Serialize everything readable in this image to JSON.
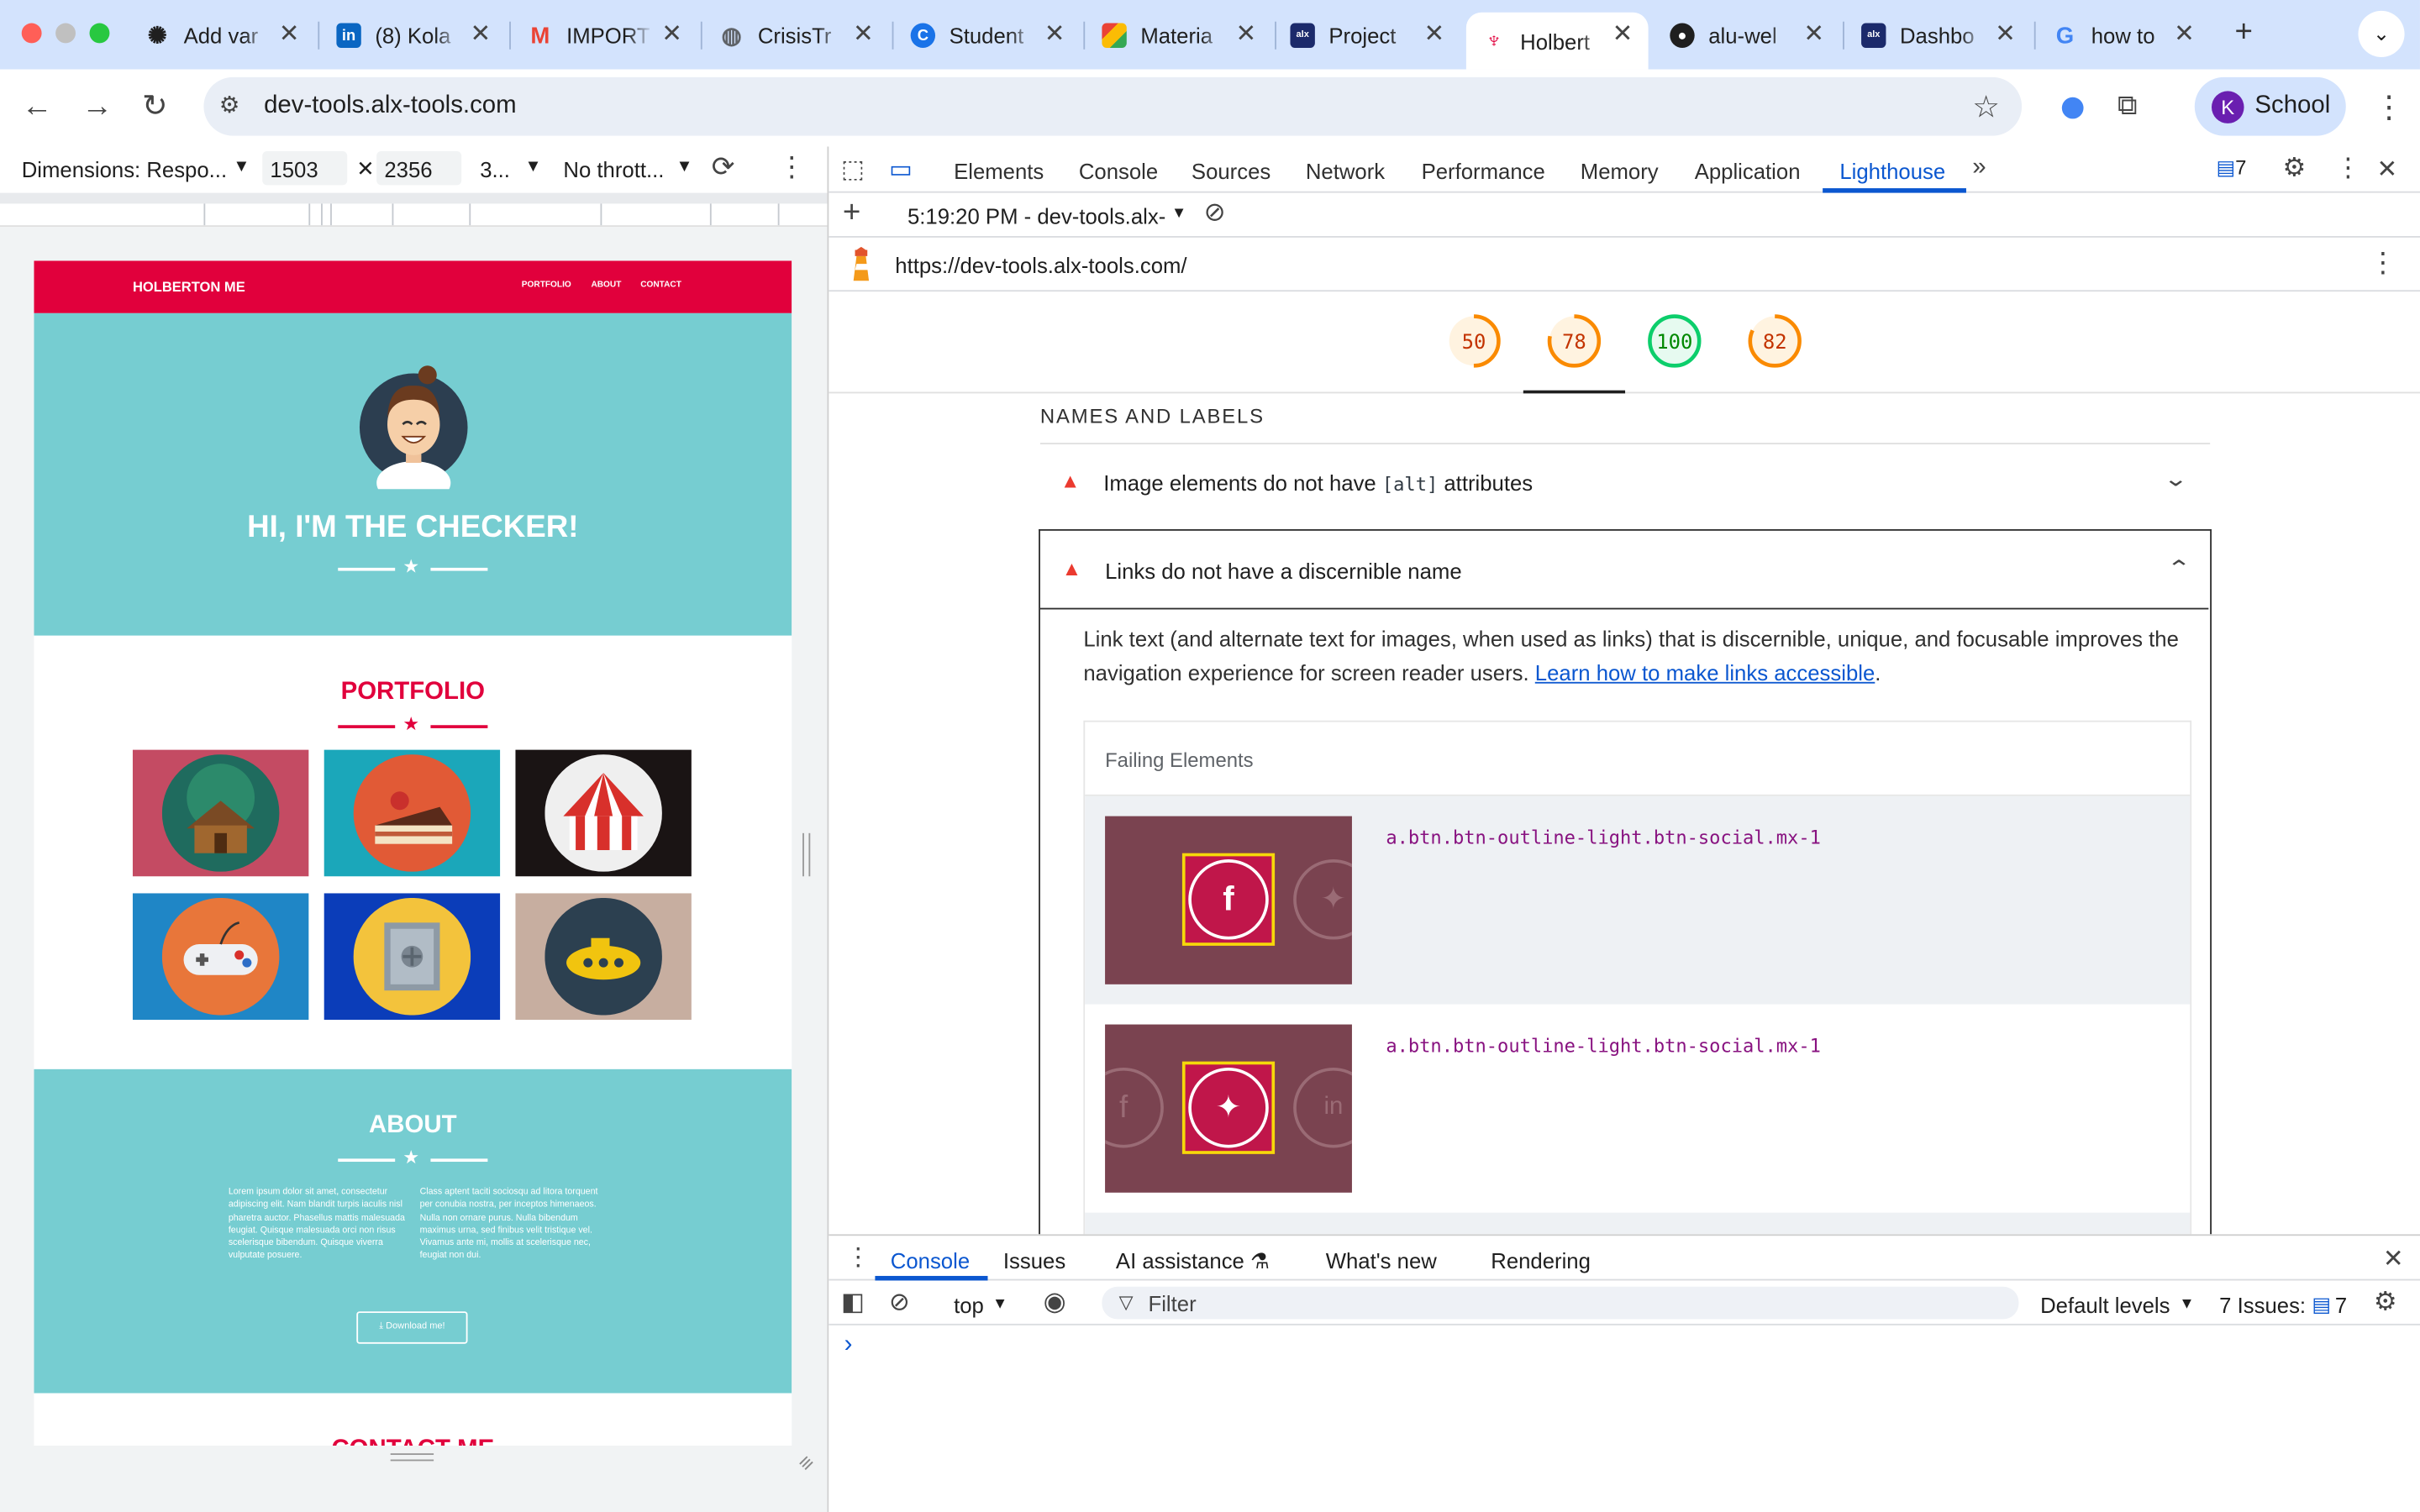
{
  "browser": {
    "tabs": [
      {
        "title": "Add var",
        "icon": "openai-icon",
        "color": "#1f1f1f"
      },
      {
        "title": "(8) Kola",
        "icon": "linkedin-icon",
        "color": "#0a66c2"
      },
      {
        "title": "IMPORT",
        "icon": "gmail-icon",
        "color": "#ea4335"
      },
      {
        "title": "CrisisTr",
        "icon": "globe-icon",
        "color": "#5f6368"
      },
      {
        "title": "Student",
        "icon": "c-logo-icon",
        "color": "#1a73e8"
      },
      {
        "title": "Materia",
        "icon": "material-icon",
        "color": "#0f9d58"
      },
      {
        "title": "Project",
        "icon": "alx-icon",
        "color": "#1b2a6b"
      },
      {
        "title": "Holbert",
        "icon": "holberton-icon",
        "color": "#e1003c"
      },
      {
        "title": "alu-wel",
        "icon": "github-icon",
        "color": "#1f1f1f"
      },
      {
        "title": "Dashbo",
        "icon": "alx-icon",
        "color": "#1b2a6b"
      },
      {
        "title": "how to",
        "icon": "google-icon",
        "color": "#4285f4"
      }
    ],
    "url": "dev-tools.alx-tools.com",
    "profile_initial": "K",
    "profile_label": "School"
  },
  "device_toolbar": {
    "dimensions": "Dimensions: Respo...",
    "width": "1503",
    "height": "2356",
    "zoom": "3...",
    "throttle": "No thrott..."
  },
  "preview": {
    "brand": "HOLBERTON ME",
    "nav": [
      "PORTFOLIO",
      "ABOUT",
      "CONTACT"
    ],
    "hero_title": "HI, I'M THE CHECKER!",
    "portfolio_title": "PORTFOLIO",
    "about_title": "ABOUT",
    "about_left": "Lorem ipsum dolor sit amet, consectetur adipiscing elit. Nam blandit turpis iaculis nisl pharetra auctor. Phasellus mattis malesuada feugiat. Quisque malesuada orci non risus scelerisque bibendum. Quisque viverra vulputate posuere.",
    "about_right": "Class aptent taciti sociosqu ad litora torquent per conubia nostra, per inceptos himenaeos. Nulla non ornare purus. Nulla bibendum maximus urna, sed finibus velit tristique vel. Vivamus ante mi, mollis at scelerisque nec, feugiat non dui.",
    "download_label": "Download me!",
    "contact_title": "CONTACT ME",
    "tiles": [
      {
        "name": "cabin",
        "bg": "#c44b63"
      },
      {
        "name": "cake",
        "bg": "#1ba7ba"
      },
      {
        "name": "circus",
        "bg": "#1a1414"
      },
      {
        "name": "controller",
        "bg": "#1f86c6"
      },
      {
        "name": "safe",
        "bg": "#0b3db9"
      },
      {
        "name": "submarine",
        "bg": "#c7aea0"
      }
    ]
  },
  "devtools": {
    "tabs": [
      "Elements",
      "Console",
      "Sources",
      "Network",
      "Performance",
      "Memory",
      "Application",
      "Lighthouse"
    ],
    "active_tab": "Lighthouse",
    "issues_count": "7",
    "report_selector": "5:19:20 PM - dev-tools.alx-",
    "report_url": "https://dev-tools.alx-tools.com/",
    "scores": [
      50,
      78,
      100,
      82
    ],
    "section_title": "NAMES AND LABELS",
    "audit1_before": "Image elements do not have ",
    "audit1_code": "[alt]",
    "audit1_after": " attributes",
    "audit2_title": "Links do not have a discernible name",
    "audit2_desc": "Link text (and alternate text for images, when used as links) that is discernible, unique, and focusable improves the navigation experience for screen reader users. ",
    "audit2_link": "Learn how to make links accessible",
    "failing_header": "Failing Elements",
    "failing": [
      {
        "selector": "a.btn.btn-outline-light.btn-social.mx-1"
      },
      {
        "selector": "a.btn.btn-outline-light.btn-social.mx-1"
      }
    ]
  },
  "drawer": {
    "tabs": [
      "Console",
      "Issues",
      "AI assistance",
      "What's new",
      "Rendering"
    ],
    "active": "Console",
    "context": "top",
    "filter_placeholder": "Filter",
    "levels": "Default levels",
    "issues_label": "7 Issues:",
    "issues_count": "7",
    "prompt": "›"
  },
  "colors": {
    "brand_red": "#e1003c",
    "teal": "#76cdd1",
    "lh_orange": "#fa8a00",
    "lh_green": "#0cce6b",
    "lh_red": "#eb3a2f",
    "link_blue": "#0b57d0"
  }
}
